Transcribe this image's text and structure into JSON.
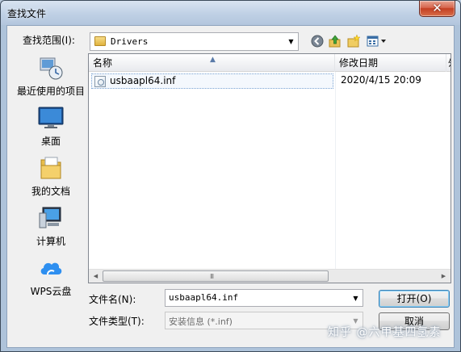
{
  "window": {
    "title": "查找文件",
    "close_glyph": "✕"
  },
  "lookin": {
    "label": "查找范围(I):",
    "value": "Drivers",
    "folder_icon": "folder-icon"
  },
  "toolbar": {
    "icons": [
      "back-icon",
      "up-folder-icon",
      "new-folder-icon",
      "view-menu-icon"
    ]
  },
  "places": [
    {
      "label": "最近使用的项目",
      "icon": "recent-items-icon"
    },
    {
      "label": "桌面",
      "icon": "desktop-icon"
    },
    {
      "label": "我的文档",
      "icon": "documents-icon"
    },
    {
      "label": "计算机",
      "icon": "computer-icon"
    },
    {
      "label": "WPS云盘",
      "icon": "cloud-icon"
    }
  ],
  "filelist": {
    "columns": [
      "名称",
      "修改日期",
      "ﾀ"
    ],
    "rows": [
      {
        "name": "usbaapl64.inf",
        "modified": "2020/4/15 20:09"
      }
    ],
    "grip": "III"
  },
  "filename": {
    "label": "文件名(N):",
    "value": "usbaapl64.inf"
  },
  "filetype": {
    "label": "文件类型(T):",
    "value": "安装信息 (*.inf)"
  },
  "buttons": {
    "open": "打开(O)",
    "cancel": "取消"
  },
  "watermark": "知乎 @六甲基四氢素"
}
